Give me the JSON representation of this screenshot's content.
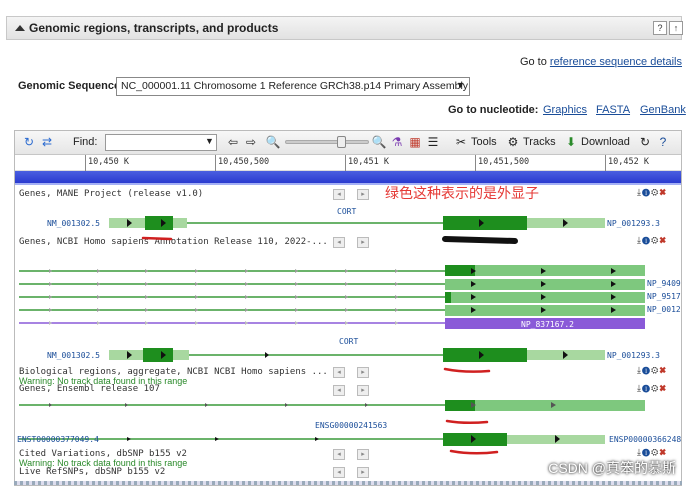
{
  "header": {
    "title": "Genomic regions, transcripts, and products",
    "btn_help": "?",
    "btn_close": "↑"
  },
  "goto_ref": {
    "prefix": "Go to",
    "link": "reference sequence details"
  },
  "genomic_sequence": {
    "label": "Genomic Sequence:",
    "value": "NC_000001.11 Chromosome 1 Reference GRCh38.p14 Primary Assembly"
  },
  "goto_nucleotide": {
    "label": "Go to nucleotide:",
    "links": [
      "Graphics",
      "FASTA",
      "GenBank"
    ]
  },
  "toolbar": {
    "find_label": "Find:",
    "tools": "Tools",
    "tracks": "Tracks",
    "download": "Download"
  },
  "ruler": {
    "ticks": [
      "10,450 K",
      "10,450,500",
      "10,451 K",
      "10,451,500",
      "10,452 K"
    ]
  },
  "tracks": {
    "mane": "Genes, MANE Project (release v1.0)",
    "ncbi": "Genes, NCBI Homo sapiens Annotation Release 110, 2022-...",
    "bio": "Biological regions, aggregate, NCBI NCBI Homo sapiens ...",
    "ensembl": "Genes, Ensembl release 107",
    "cited": "Cited Variations, dbSNP b155 v2",
    "live": "Live RefSNPs, dbSNP b155 v2",
    "warning": "Warning: No track data found in this range"
  },
  "genes": {
    "cort": "CORT",
    "nm1": "NM_001302.5",
    "np1": "NP_001293.3",
    "np_a": "NP_9409",
    "np_b": "NP_9517",
    "np_c": "NP_0012",
    "np_purple": "NP_837167.2",
    "nm2": "NM_001302.5",
    "cort2": "CORT",
    "np2": "NP_001293.3",
    "ensg": "ENSG00000241563",
    "enst": "ENST00000377049.4",
    "ensp": "ENSP00000366248."
  },
  "annotation": "绿色这种表示的是外显子",
  "watermark": "CSDN @真笨的慕斯"
}
